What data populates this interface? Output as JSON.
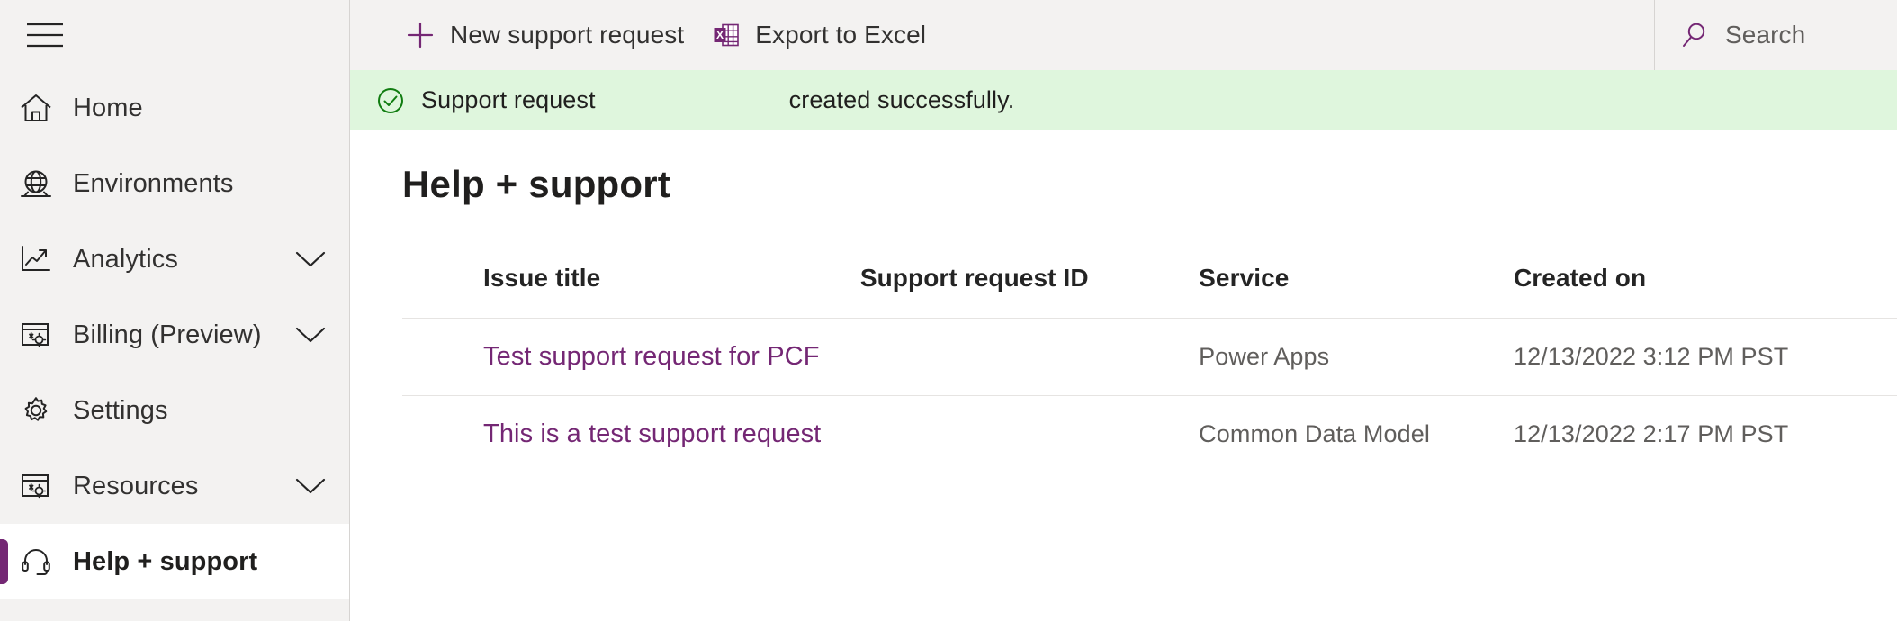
{
  "sidebar": {
    "menu_icon": "hamburger-icon",
    "items": [
      {
        "label": "Home",
        "icon": "home-icon",
        "has_chevron": false,
        "selected": false
      },
      {
        "label": "Environments",
        "icon": "globe-icon",
        "has_chevron": false,
        "selected": false
      },
      {
        "label": "Analytics",
        "icon": "line-chart-icon",
        "has_chevron": true,
        "selected": false
      },
      {
        "label": "Billing (Preview)",
        "icon": "billing-window-icon",
        "has_chevron": true,
        "selected": false
      },
      {
        "label": "Settings",
        "icon": "gear-icon",
        "has_chevron": false,
        "selected": false
      },
      {
        "label": "Resources",
        "icon": "resources-window-icon",
        "has_chevron": true,
        "selected": false
      },
      {
        "label": "Help + support",
        "icon": "headset-icon",
        "has_chevron": false,
        "selected": true
      }
    ]
  },
  "commandbar": {
    "new_request_label": "New support request",
    "new_request_icon": "plus-icon",
    "export_label": "Export to Excel",
    "export_icon": "excel-icon"
  },
  "search": {
    "placeholder": "Search",
    "icon": "search-icon"
  },
  "banner": {
    "icon": "check-circle-icon",
    "text_before": "Support request",
    "text_after": "created successfully.",
    "color": "#dff6dd",
    "icon_color": "#107c10"
  },
  "page": {
    "title": "Help + support"
  },
  "table": {
    "columns": [
      "Issue title",
      "Support request ID",
      "Service",
      "Created on"
    ],
    "rows": [
      {
        "issue_title": "Test support request for PCF",
        "support_request_id": "",
        "service": "Power Apps",
        "created_on": "12/13/2022 3:12 PM PST"
      },
      {
        "issue_title": "This is a test support request",
        "support_request_id": "",
        "service": "Common Data Model",
        "created_on": "12/13/2022 2:17 PM PST"
      }
    ]
  },
  "theme": {
    "accent": "#742774",
    "sidebar_bg": "#f3f2f1",
    "link": "#742774"
  }
}
